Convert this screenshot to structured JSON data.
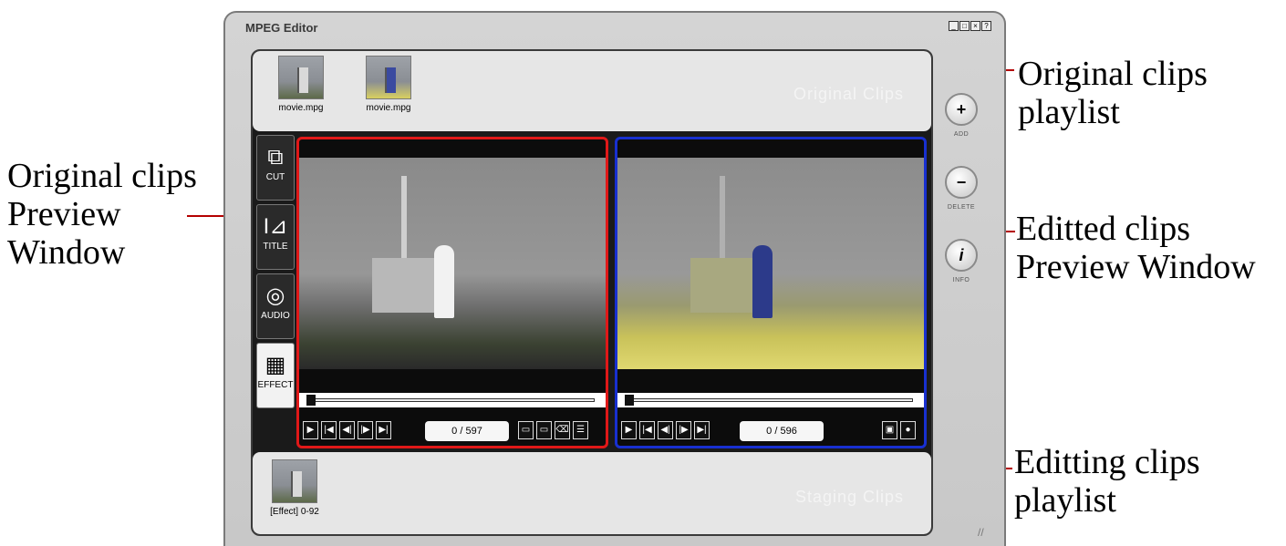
{
  "window": {
    "title": "MPEG Editor",
    "controls": [
      "minimize",
      "maximize",
      "close",
      "help"
    ],
    "control_glyphs": [
      "_",
      "□",
      "×",
      "?"
    ]
  },
  "original_playlist": {
    "watermark": "Original Clips",
    "clips": [
      {
        "label": "movie.mpg",
        "thumb_icon": "shuttle-thumbnail"
      },
      {
        "label": "movie.mpg",
        "thumb_icon": "edited-shuttle-thumbnail"
      }
    ]
  },
  "tools": [
    {
      "label": "CUT",
      "icon": "film-cut-icon",
      "glyph": "⧉"
    },
    {
      "label": "TITLE",
      "icon": "title-text-icon",
      "glyph": "I⊿"
    },
    {
      "label": "AUDIO",
      "icon": "music-disc-icon",
      "glyph": "◎"
    },
    {
      "label": "EFFECT",
      "icon": "effect-grid-icon",
      "glyph": "▦",
      "active": true
    }
  ],
  "preview_original": {
    "frame_counter": "0 / 597",
    "border_color": "#e01818",
    "transport": [
      "play",
      "go-start",
      "step-back",
      "step-forward",
      "go-end"
    ],
    "extra_buttons": [
      "mark-in",
      "mark-out",
      "erase",
      "effect-list"
    ]
  },
  "preview_edited": {
    "frame_counter": "0 / 596",
    "border_color": "#1830d0",
    "transport": [
      "play",
      "go-start",
      "step-back",
      "step-forward",
      "go-end"
    ],
    "extra_buttons": [
      "monitor",
      "record"
    ]
  },
  "staging_playlist": {
    "watermark": "Staging Clips",
    "clips": [
      {
        "label": "[Effect] 0-92",
        "thumb_icon": "shuttle-thumbnail"
      }
    ]
  },
  "side_buttons": [
    {
      "glyph": "+",
      "label": "ADD"
    },
    {
      "glyph": "−",
      "label": "DELETE"
    },
    {
      "glyph": "i",
      "label": "INFO"
    }
  ],
  "callouts": {
    "original_playlist_line1": "Original clips",
    "original_playlist_line2": "playlist",
    "original_preview_line1": "Original clips",
    "original_preview_line2": "Preview",
    "original_preview_line3": "Window",
    "edited_preview_line1": "Editted clips",
    "edited_preview_line2": "Preview Window",
    "editing_playlist_line1": "Editting clips",
    "editing_playlist_line2": "playlist"
  },
  "colors": {
    "leader_line": "#b40000",
    "original_border": "#e01818",
    "edited_border": "#1830d0"
  }
}
